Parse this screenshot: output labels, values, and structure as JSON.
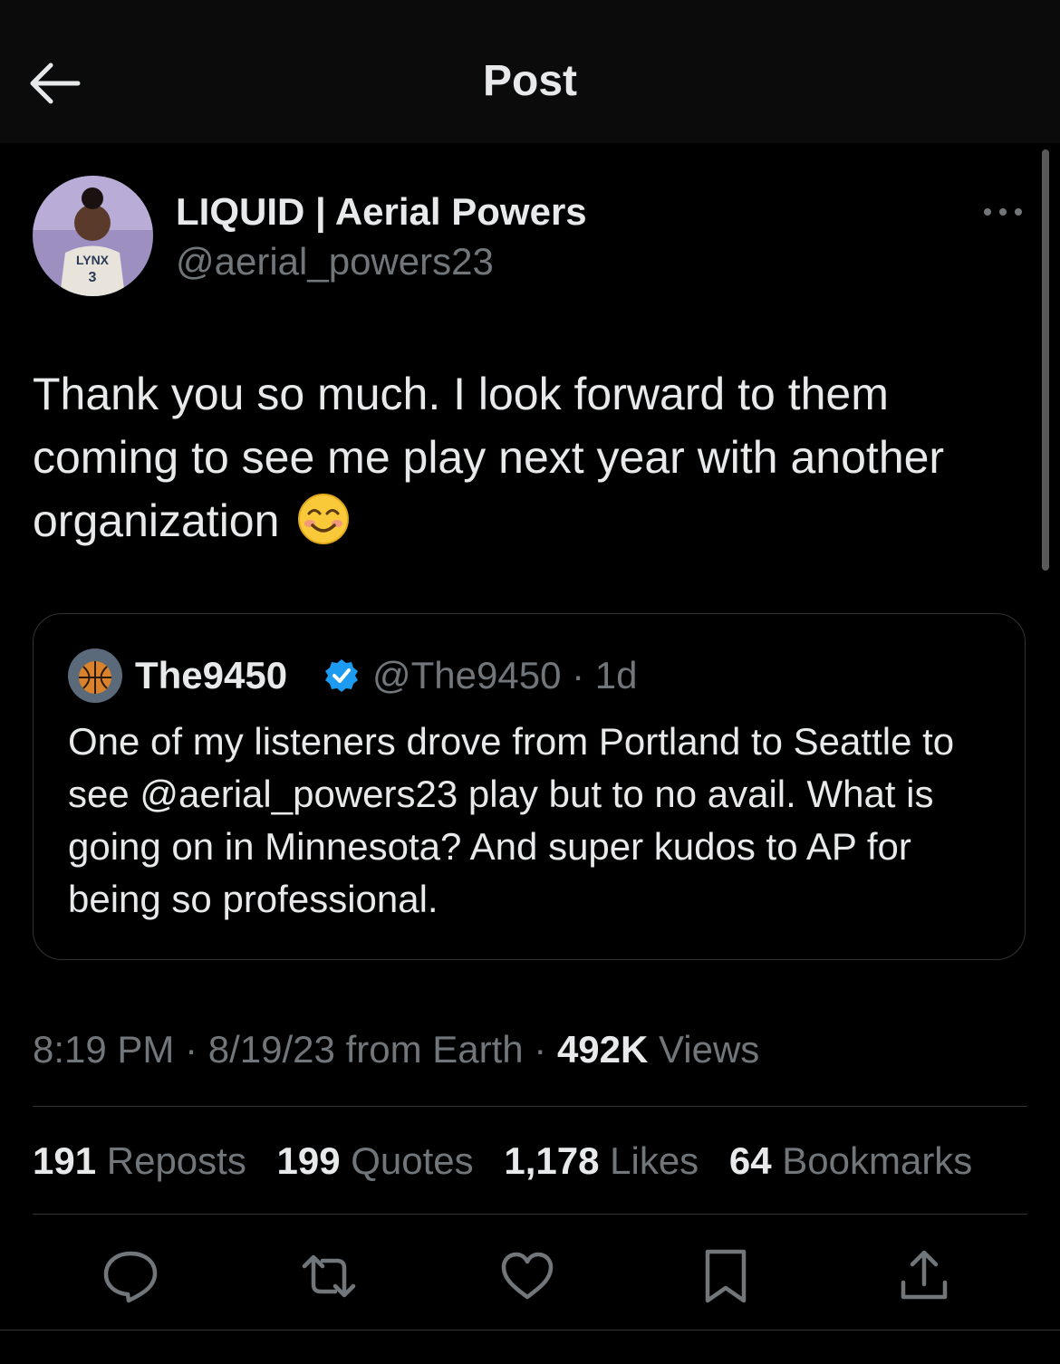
{
  "header": {
    "title": "Post"
  },
  "tweet": {
    "display_name": "LIQUID | Aerial Powers",
    "handle": "@aerial_powers23",
    "text": "Thank you so much. I look forward to them coming to see me play next year with another organization",
    "emoji": "😊",
    "avatar_jersey_text": "LYNX",
    "avatar_jersey_number": "3"
  },
  "quote": {
    "name": "The9450",
    "handle": "@The9450",
    "time": "1d",
    "text": "One of my listeners drove from Portland to Seattle to see @aerial_powers23 play but to no avail. What is going on in Minnesota? And super kudos to AP for being so professional."
  },
  "meta": {
    "time": "8:19 PM",
    "date": "8/19/23",
    "source": "from Earth",
    "views_count": "492K",
    "views_label": "Views"
  },
  "stats": {
    "reposts_count": "191",
    "reposts_label": "Reposts",
    "quotes_count": "199",
    "quotes_label": "Quotes",
    "likes_count": "1,178",
    "likes_label": "Likes",
    "bookmarks_count": "64",
    "bookmarks_label": "Bookmarks"
  },
  "colors": {
    "background": "#000000",
    "text_primary": "#e7e9ea",
    "text_secondary": "#71767b",
    "border": "#2f3336",
    "verified_blue": "#1d9bf0"
  },
  "icons": [
    "back-arrow-icon",
    "more-icon",
    "verified-badge-icon",
    "reply-icon",
    "repost-icon",
    "like-icon",
    "bookmark-icon",
    "share-icon"
  ]
}
